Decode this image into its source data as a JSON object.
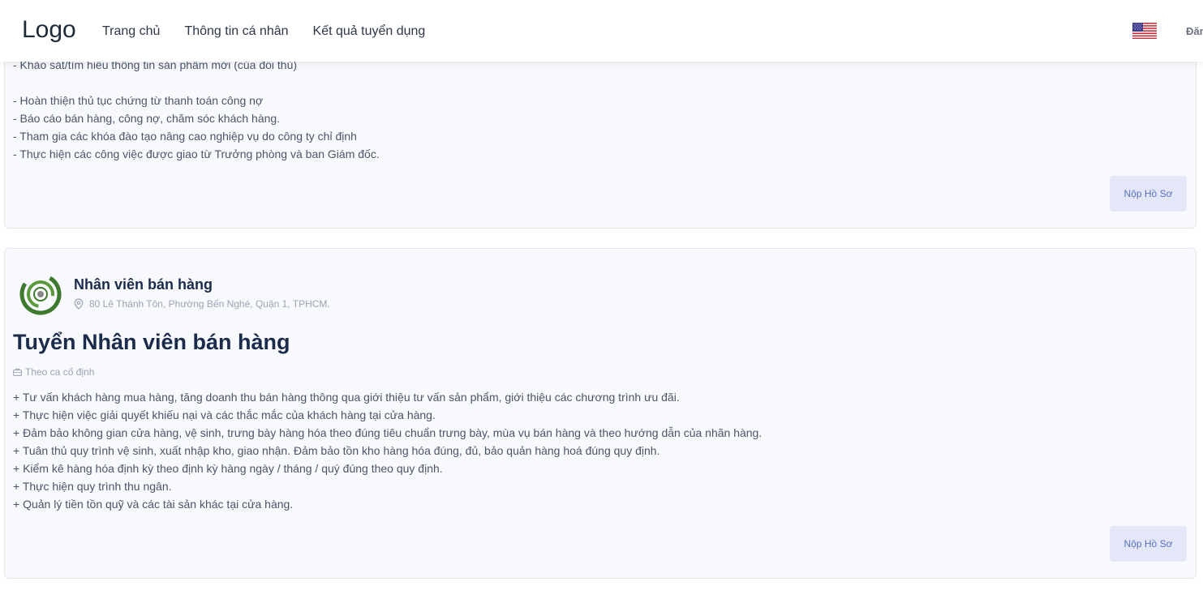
{
  "header": {
    "logo": "Logo",
    "nav": [
      "Trang chủ",
      "Thông tin cá nhân",
      "Kết quả tuyển dụng"
    ],
    "login": "Đăng nhập"
  },
  "jobs": [
    {
      "description": "- Khảo sát/tìm hiểu thông tin sản phẩm mới (của đối thủ)\n\n- Hoàn thiện thủ tục chứng từ thanh toán công nợ\n- Báo cáo bán hàng, công nợ, chăm sóc khách hàng.\n- Tham gia các khóa đào tạo nâng cao nghiệp vụ do công ty chỉ định\n- Thực hiện các công việc được giao từ Trưởng phòng và ban Giám đốc.",
      "apply_label": "Nộp Hồ Sơ"
    },
    {
      "company_name": "Nhân viên bán hàng",
      "address": "80 Lê Thánh Tôn, Phường Bến Nghé, Quận 1, TPHCM.",
      "title": "Tuyển Nhân viên bán hàng",
      "shift": "Theo ca cố định",
      "description": "+ Tư vấn khách hàng mua hàng, tăng doanh thu bán hàng thông qua giới thiệu tư vấn sản phẩm, giới thiệu các chương trình ưu đãi.\n+ Thực hiện việc giải quyết khiếu nại và các thắc mắc của khách hàng tại cửa hàng.\n+ Đảm bảo không gian cửa hàng, vệ sinh, trưng bày hàng hóa theo đúng tiêu chuẩn trưng bày, mùa vụ bán hàng và theo hướng dẫn của nhãn hàng.\n+ Tuân thủ quy trình vệ sinh, xuất nhập kho, giao nhận. Đảm bảo tồn kho hàng hóa đúng, đủ, bảo quản hàng hoá đúng quy định.\n+ Kiểm kê hàng hóa định kỳ theo định kỳ hàng ngày / tháng / quý đúng theo quy định.\n+ Thực hiện quy trình thu ngân.\n+ Quản lý tiền tồn quỹ và các tài sản khác tại cửa hàng.",
      "apply_label": "Nộp Hồ Sơ"
    }
  ],
  "colors": {
    "accent": "#5b6fc4",
    "title": "#1a2b4b",
    "card_bg": "#f8f9fd",
    "logo_green": "#3d7a2e"
  }
}
